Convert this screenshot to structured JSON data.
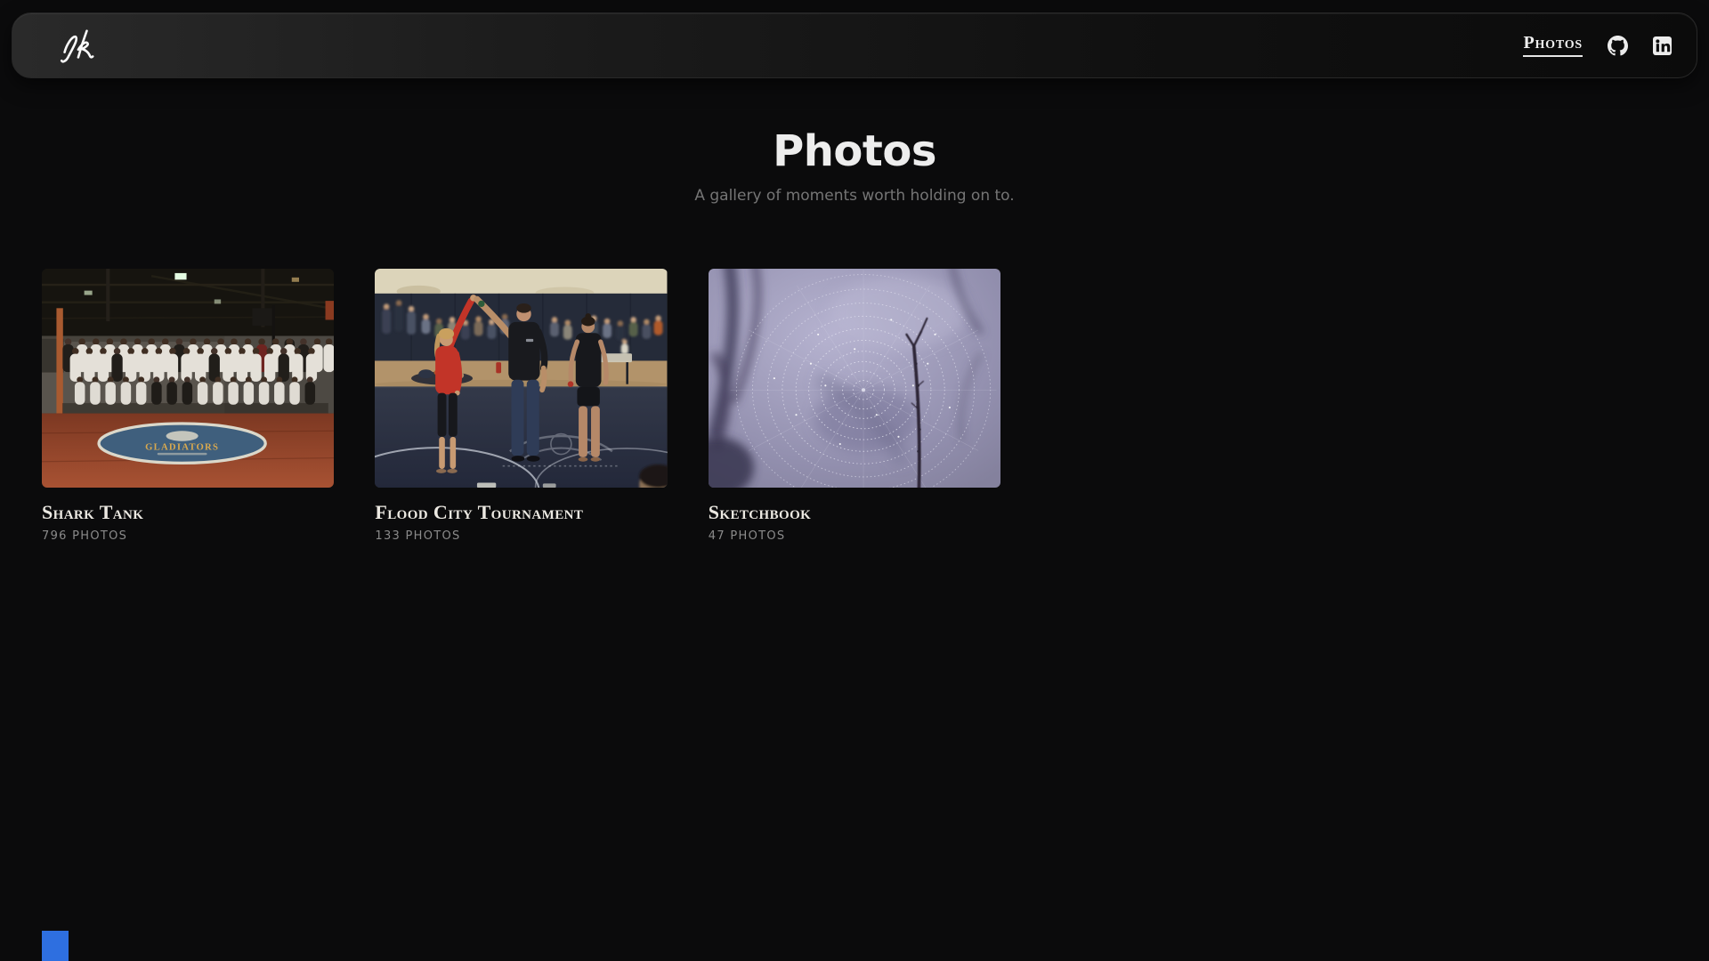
{
  "navbar": {
    "logo": "nk signature",
    "photos_label": "Photos"
  },
  "header": {
    "title": "Photos",
    "subtitle": "A gallery of moments worth holding on to."
  },
  "albums": [
    {
      "title": "Shark Tank",
      "count": "796 PHOTOS",
      "cover": "team group photo in gym, white and black gis, red mat with blue oval logo",
      "mat_logo_text": "GLADIATORS"
    },
    {
      "title": "Flood City Tournament",
      "count": "133 PHOTOS",
      "cover": "referee raising winner's hand between two competitors on navy wrestling mat"
    },
    {
      "title": "Sketchbook",
      "count": "47 PHOTOS",
      "cover": "dew covered spider web between dark branches in misty lavender light"
    }
  ],
  "colors": {
    "page_background": "#0b0b0c",
    "navbar_left": "#2a2a2a",
    "navbar_right": "#0b0b0b",
    "heading_text": "#ededed",
    "muted_text": "#8b8b8b",
    "bottom_left_marker": "#2e6fe0"
  }
}
